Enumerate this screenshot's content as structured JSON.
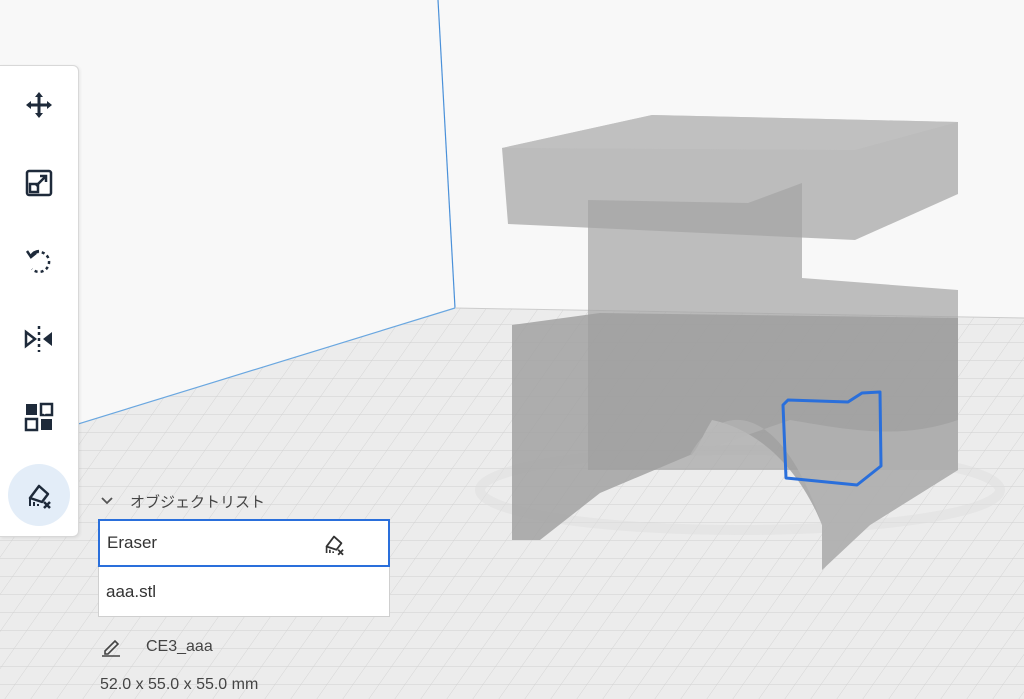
{
  "toolbar": {
    "tools": [
      {
        "name": "move-icon",
        "active": false
      },
      {
        "name": "scale-icon",
        "active": false
      },
      {
        "name": "rotate-icon",
        "active": false
      },
      {
        "name": "mirror-icon",
        "active": false
      },
      {
        "name": "per-model-settings-icon",
        "active": false
      },
      {
        "name": "support-eraser-icon",
        "active": true
      }
    ]
  },
  "object_list": {
    "header_label": "オブジェクトリスト",
    "items": [
      {
        "label": "Eraser",
        "selected": true,
        "icon": "support-eraser-icon"
      },
      {
        "label": "aaa.stl",
        "selected": false
      }
    ]
  },
  "printer": {
    "name": "CE3_aaa",
    "icon": "pencil-icon"
  },
  "dimensions": "52.0 x 55.0 x 55.0 mm",
  "colors": {
    "accent": "#2a6fdb",
    "toolbar_icon": "#1e2a3a",
    "build_plate_grid": "#cfcfcf",
    "model": "#a6a6a6"
  }
}
